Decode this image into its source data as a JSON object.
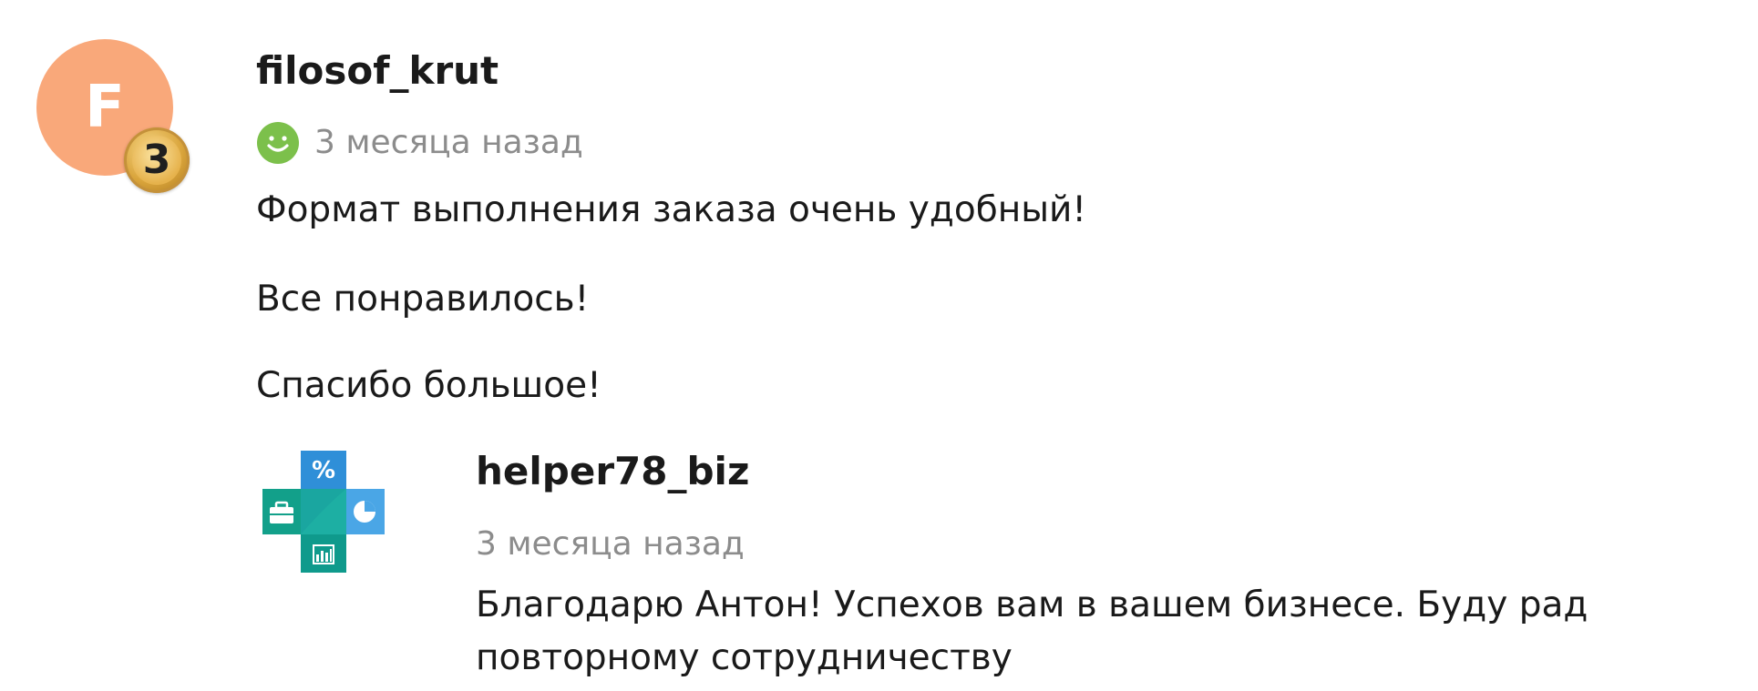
{
  "review": {
    "avatar_letter": "F",
    "avatar_color": "#f9a87a",
    "level": "3",
    "author": "filosof_krut",
    "rating_icon": "smile-icon",
    "rating_color": "#7cc04b",
    "time": "3 месяца назад",
    "paragraphs": [
      "Формат выполнения заказа очень удобный!",
      "Все понравилось!",
      "Спасибо большое!"
    ]
  },
  "reply": {
    "logo_icon": "business-cross-logo",
    "author": "helper78_biz",
    "time": "3 месяца назад",
    "text": "Благодарю Антон! Успехов вам в вашем бизнесе. Буду рад повторному сотрудничеству"
  }
}
